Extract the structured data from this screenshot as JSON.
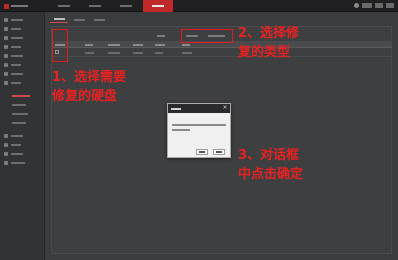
{
  "colors": {
    "accent": "#c0282a",
    "annotation": "#e62222",
    "background": "#3b3c3e",
    "dialog_background": "#f0f0f0"
  },
  "topbar": {
    "logo_icon": "brand-logo-icon",
    "tabs": [
      {
        "label": "",
        "active": false
      },
      {
        "label": "",
        "active": false
      },
      {
        "label": "",
        "active": false
      },
      {
        "label": "",
        "active": false
      },
      {
        "label": "",
        "active": true
      }
    ]
  },
  "sidebar": {
    "items": [
      {
        "label": ""
      },
      {
        "label": ""
      },
      {
        "label": ""
      },
      {
        "label": ""
      },
      {
        "label": ""
      },
      {
        "label": ""
      },
      {
        "label": ""
      },
      {
        "label": ""
      },
      {
        "label": ""
      },
      {
        "label": ""
      },
      {
        "label": ""
      },
      {
        "label": ""
      },
      {
        "label": ""
      },
      {
        "label": ""
      },
      {
        "label": ""
      },
      {
        "label": ""
      }
    ]
  },
  "content": {
    "tabs": [
      {
        "label": ""
      },
      {
        "label": ""
      },
      {
        "label": ""
      }
    ],
    "option_buttons": [
      {
        "label": ""
      },
      {
        "label": ""
      },
      {
        "label": ""
      }
    ],
    "table_headers": [
      "",
      "",
      "",
      "",
      "",
      ""
    ]
  },
  "annotations": {
    "step1": "1、选择需要\n修复的硬盘",
    "step2": "2、选择修\n复的类型",
    "step3": "3、对话框\n中点击确定"
  },
  "dialog": {
    "title": "",
    "message": "",
    "confirm_label": "",
    "cancel_label": ""
  }
}
